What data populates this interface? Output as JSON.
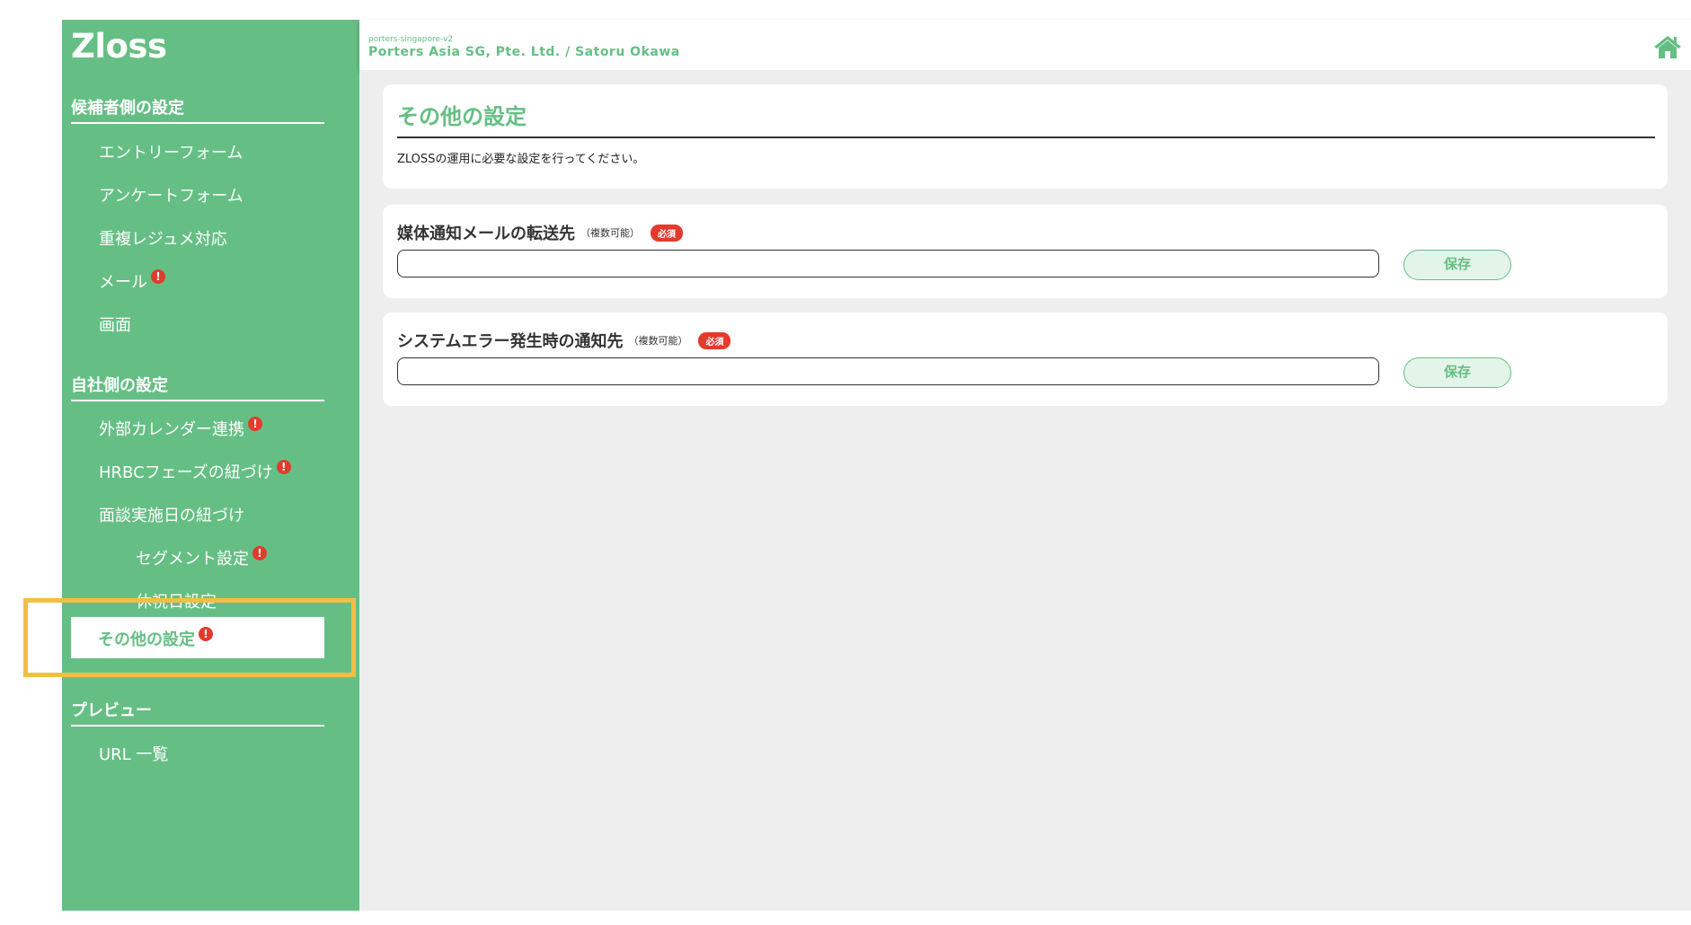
{
  "app": {
    "logo": "Zloss"
  },
  "header": {
    "tenant": "porters-singapore-v2",
    "org_user": "Porters Asia SG, Pte. Ltd. / Satoru Okawa"
  },
  "sidebar": {
    "candidate_section": "候補者側の設定",
    "candidate_items": [
      "エントリーフォーム",
      "アンケートフォーム",
      "重複レジュメ対応",
      "メール",
      "画面"
    ],
    "company_section": "自社側の設定",
    "company_items": [
      "外部カレンダー連携",
      "HRBCフェーズの紐づけ",
      "面談実施日の紐づけ"
    ],
    "company_subitems": [
      "セグメント設定",
      "休祝日設定"
    ],
    "active_item": "その他の設定",
    "preview_section": "プレビュー",
    "preview_items": [
      "URL 一覧"
    ],
    "alert_glyph": "!"
  },
  "main": {
    "title": "その他の設定",
    "description": "ZLOSSの運用に必要な設定を行ってください。",
    "fields": [
      {
        "label": "媒体通知メールの転送先",
        "note": "（複数可能）",
        "badge": "必須",
        "value": "",
        "save_label": "保存"
      },
      {
        "label": "システムエラー発生時の通知先",
        "note": "（複数可能）",
        "badge": "必須",
        "value": "",
        "save_label": "保存"
      }
    ]
  },
  "colors": {
    "brand": "#65bf84",
    "alert": "#e23b2e",
    "highlight": "#f2bf43",
    "content_bg": "#eeeeee"
  },
  "icons": {
    "home": "home-icon",
    "alert": "alert-icon"
  }
}
